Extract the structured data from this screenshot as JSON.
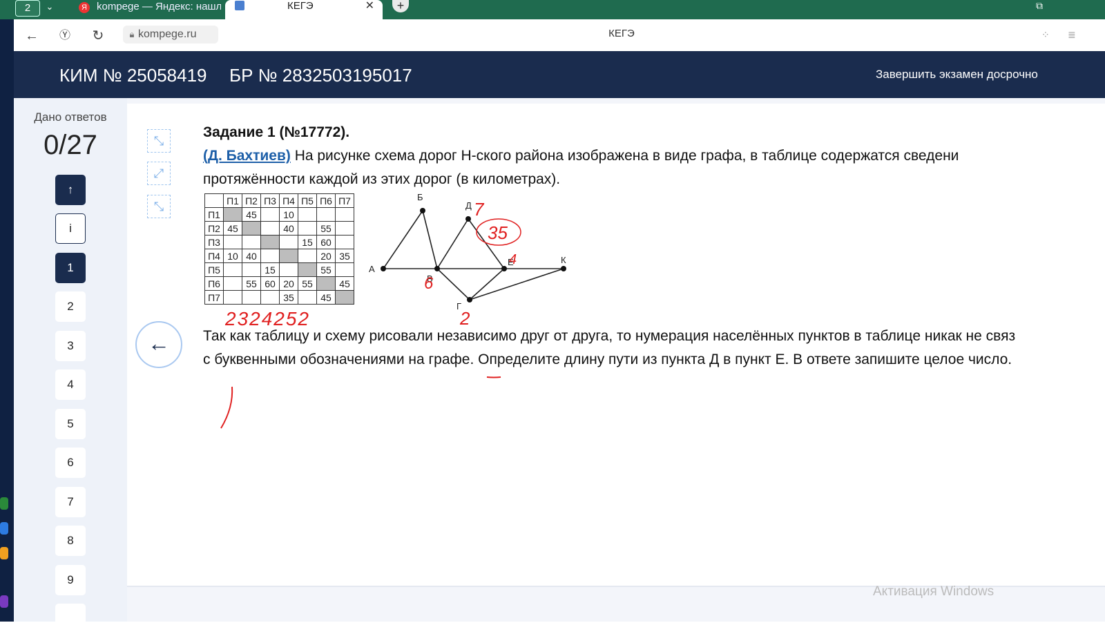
{
  "browser": {
    "tab_count": "2",
    "tabs": [
      {
        "title": "kompege — Яндекс: нашл",
        "favicon": "Я"
      },
      {
        "title": "КЕГЭ"
      }
    ],
    "new_tab": "+",
    "url": "kompege.ru",
    "page_title": "КЕГЭ"
  },
  "header": {
    "kim": "КИМ № 25058419",
    "br": "БР № 2832503195017",
    "finish_label": "Завершить экзамен досрочно"
  },
  "sidebar": {
    "given_label": "Дано ответов",
    "score": "0/27",
    "up_label": "↑",
    "info_label": "i",
    "questions": [
      "1",
      "2",
      "3",
      "4",
      "5",
      "6",
      "7",
      "8",
      "9"
    ]
  },
  "task": {
    "title": "Задание 1 (№17772).",
    "author": "(Д. Бахтиев)",
    "intro_line1": " На рисунке схема дорог Н-ского района изображена в виде графа, в таблице содержатся сведени",
    "intro_line2": "протяжённости каждой из этих дорог (в километрах).",
    "question_line1": "Так как таблицу и схему рисовали независимо друг от друга, то нумерация населённых пунктов в таблице никак не связ",
    "question_line2": "с буквенными обозначениями на графе. Определите длину пути из пункта Д в пункт Е. В ответе запишите целое число."
  },
  "table": {
    "headers": [
      "",
      "П1",
      "П2",
      "П3",
      "П4",
      "П5",
      "П6",
      "П7"
    ],
    "rows": [
      [
        "П1",
        "#",
        "45",
        "",
        "10",
        "",
        "",
        ""
      ],
      [
        "П2",
        "45",
        "#",
        "",
        "40",
        "",
        "55",
        ""
      ],
      [
        "П3",
        "",
        "",
        "#",
        "",
        "15",
        "60",
        ""
      ],
      [
        "П4",
        "10",
        "40",
        "",
        "#",
        "",
        "20",
        "35"
      ],
      [
        "П5",
        "",
        "",
        "15",
        "",
        "#",
        "55",
        ""
      ],
      [
        "П6",
        "",
        "55",
        "60",
        "20",
        "55",
        "#",
        "45"
      ],
      [
        "П7",
        "",
        "",
        "",
        "35",
        "",
        "45",
        "#"
      ]
    ]
  },
  "graph": {
    "node_labels": [
      "А",
      "Б",
      "В",
      "Д",
      "Г",
      "Е",
      "К"
    ],
    "handwritten": [
      "7",
      "35",
      "4",
      "6",
      "2",
      "2324252"
    ]
  },
  "footer": {
    "activation": "Активация Windows"
  },
  "colors": {
    "header_bg": "#1a2c4e",
    "tabbar_bg": "#1f6b4f",
    "annotation_red": "#e02020",
    "author_link": "#1d5fa8"
  }
}
